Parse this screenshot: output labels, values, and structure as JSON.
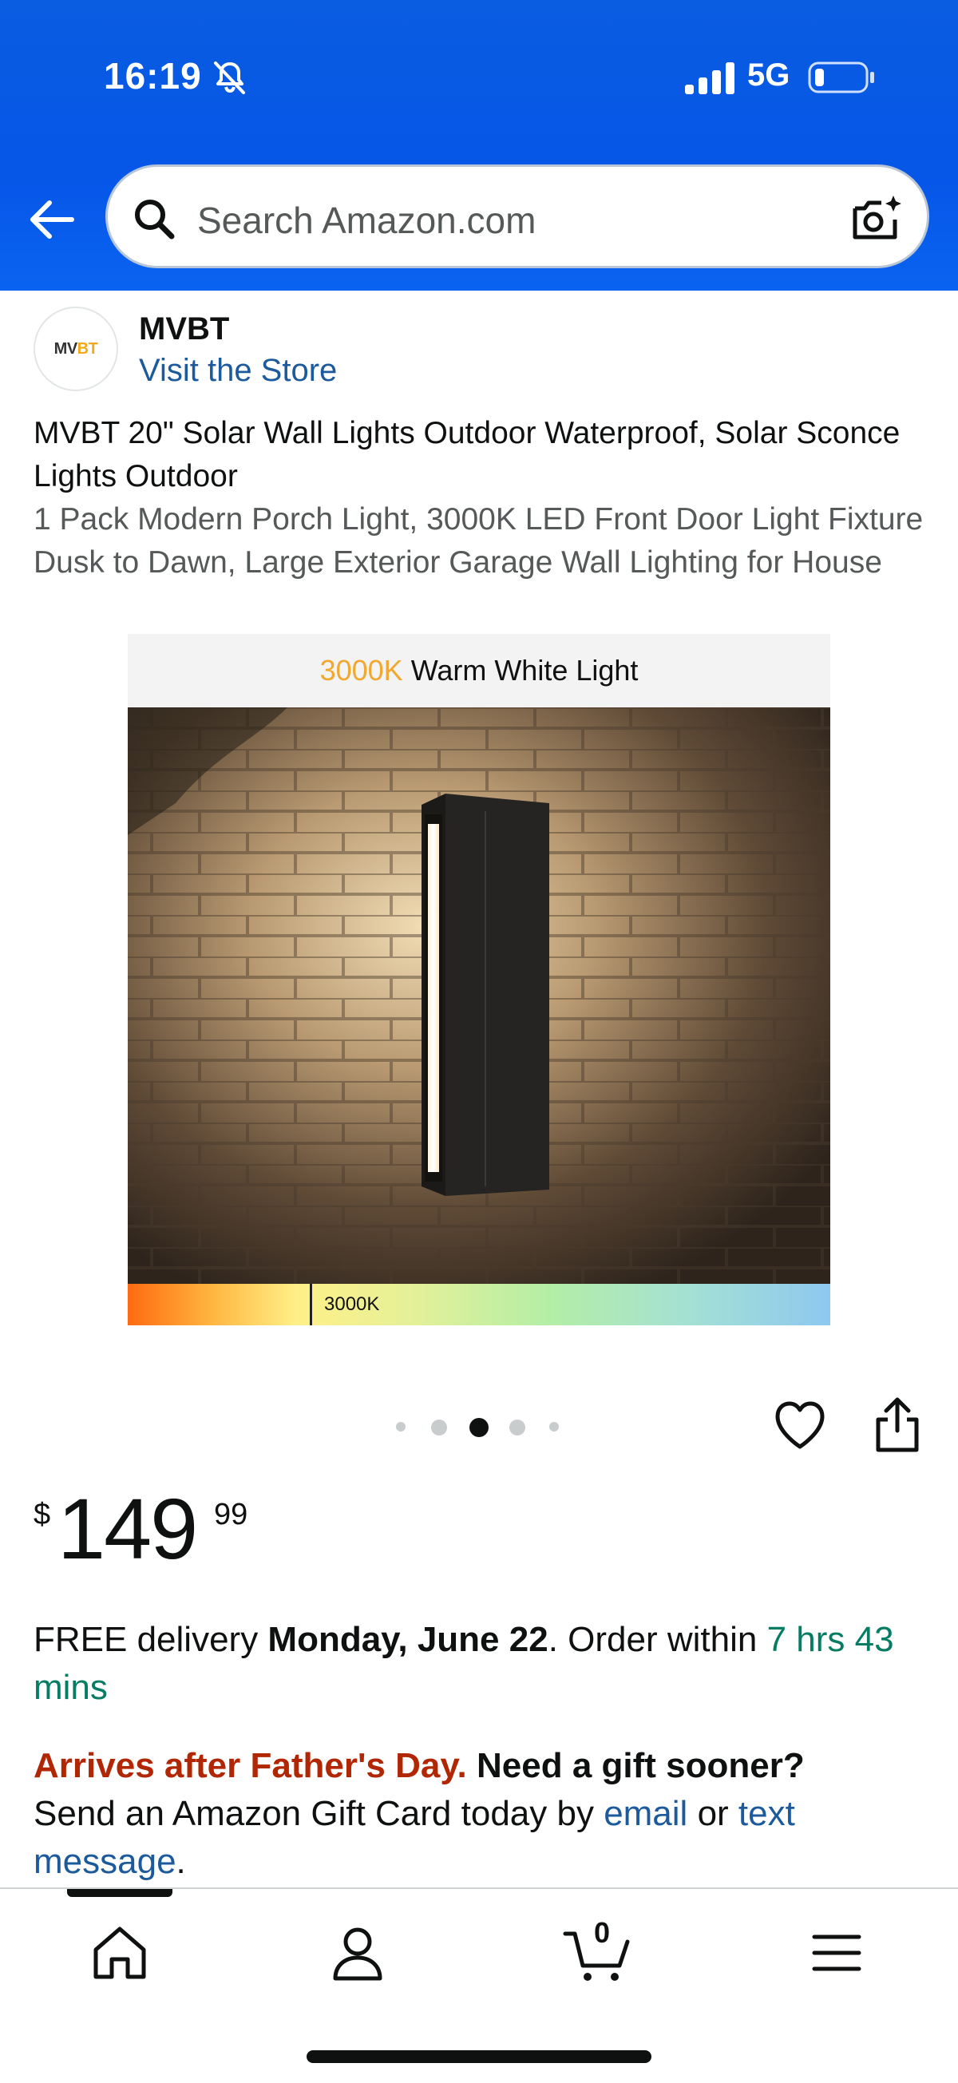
{
  "status_bar": {
    "time": "16:19",
    "network": "5G",
    "icons": [
      "bell-slash-icon",
      "cellular-signal-icon",
      "battery-icon"
    ]
  },
  "header": {
    "search_placeholder": "Search Amazon.com",
    "icons": [
      "back-arrow-icon",
      "search-icon",
      "camera-search-icon"
    ],
    "background_color": "#0656e8"
  },
  "store": {
    "logo_text_a": "MV",
    "logo_text_b": "BT",
    "name": "MVBT",
    "link": "Visit the Store"
  },
  "product": {
    "title": "MVBT 20\" Solar Wall Lights Outdoor Waterproof, Solar Sconce Lights Outdoor",
    "subtitle": "1 Pack Modern Porch Light, 3000K LED Front Door Light Fixture Dusk to Dawn, Large Exterior Garage Wall Lighting for House"
  },
  "image": {
    "banner_temp": "3000K",
    "banner_text": "Warm White Light",
    "spectrum_label": "3000K",
    "carousel_total": 5,
    "carousel_active": 3
  },
  "actions": {
    "icons": [
      "heart-icon",
      "share-icon"
    ]
  },
  "price": {
    "symbol": "$",
    "whole": "149",
    "fraction": "99"
  },
  "delivery": {
    "prefix": "FREE delivery ",
    "date": "Monday, June 22",
    "middle": ". Order within ",
    "countdown": "7 hrs 43 mins"
  },
  "gift": {
    "warning": "Arrives after Father's Day.",
    "question": " Need a gift sooner?",
    "line": "Send an Amazon Gift Card today by ",
    "link_email": "email",
    "or": " or ",
    "link_text": "text message",
    "end": "."
  },
  "bottom_nav": {
    "items": [
      "home-icon",
      "account-icon",
      "cart-icon",
      "menu-icon"
    ],
    "cart_count": "0"
  },
  "colors": {
    "link": "#1d5a9c",
    "green": "#067d62",
    "red": "#b12704",
    "banner_accent": "#f0a830"
  }
}
